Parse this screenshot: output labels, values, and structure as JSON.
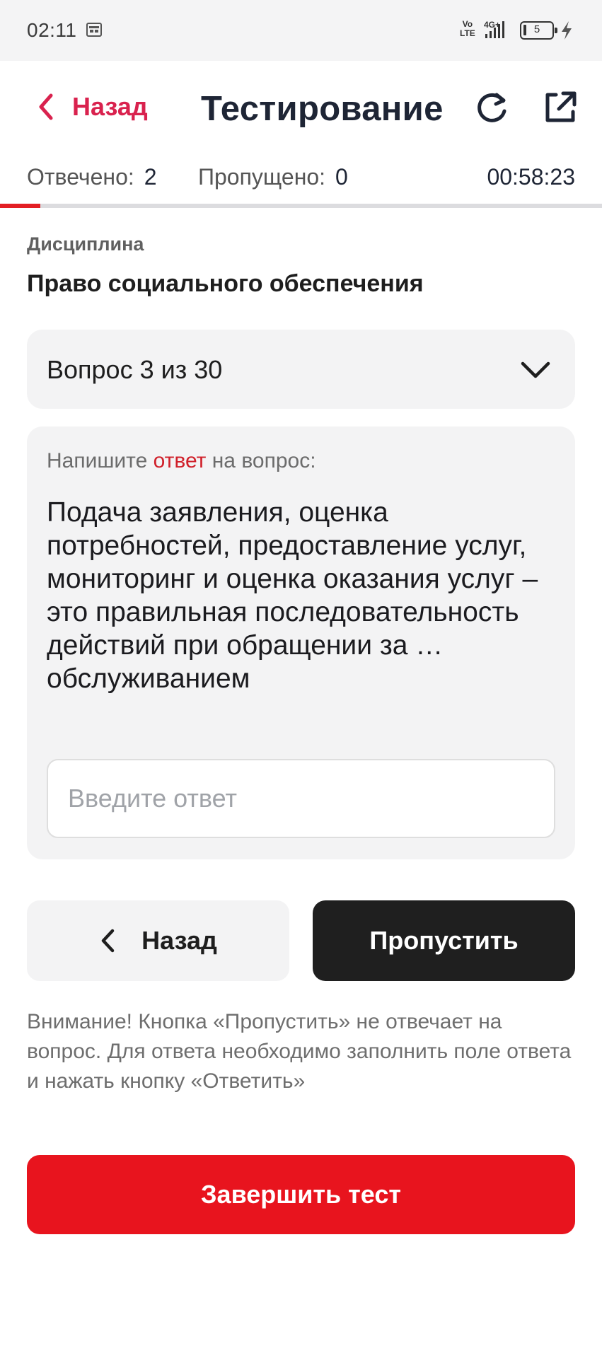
{
  "status_bar": {
    "time": "02:11",
    "network_label_top": "Vo",
    "network_label_bottom": "LTE",
    "network_type": "4G+",
    "battery_level": "5",
    "icons": [
      "calendar-icon",
      "signal-icon",
      "battery-icon",
      "charging-icon"
    ]
  },
  "header": {
    "back_label": "Назад",
    "title": "Тестирование",
    "icons": [
      "chevron-left-icon",
      "refresh-icon",
      "external-link-icon"
    ]
  },
  "stats": {
    "answered_label": "Отвечено:",
    "answered_value": "2",
    "skipped_label": "Пропущено:",
    "skipped_value": "0",
    "timer": "00:58:23",
    "progress_fraction": 0.067
  },
  "discipline": {
    "label": "Дисциплина",
    "value": "Право социального обеспечения"
  },
  "question_selector": {
    "label": "Вопрос 3 из 30"
  },
  "question": {
    "prompt_before": "Напишите ",
    "prompt_accent": "ответ",
    "prompt_after": " на вопрос:",
    "text": "Подача заявления, оценка потребностей, предоставление услуг, мониторинг и оценка оказания услуг – это правильная последовательность действий при обращении за … обслуживанием",
    "answer_value": "",
    "answer_placeholder": "Введите ответ"
  },
  "buttons": {
    "back_label": "Назад",
    "skip_label": "Пропустить",
    "finish_label": "Завершить тест"
  },
  "warning": "Внимание! Кнопка «Пропустить» не отвечает на вопрос. Для ответа необходимо заполнить поле ответа и нажать кнопку «Ответить»",
  "colors": {
    "accent_red": "#e8141e",
    "back_link_red": "#d9224e",
    "dark_button": "#1f1f1f",
    "card_background": "#f3f3f4"
  }
}
